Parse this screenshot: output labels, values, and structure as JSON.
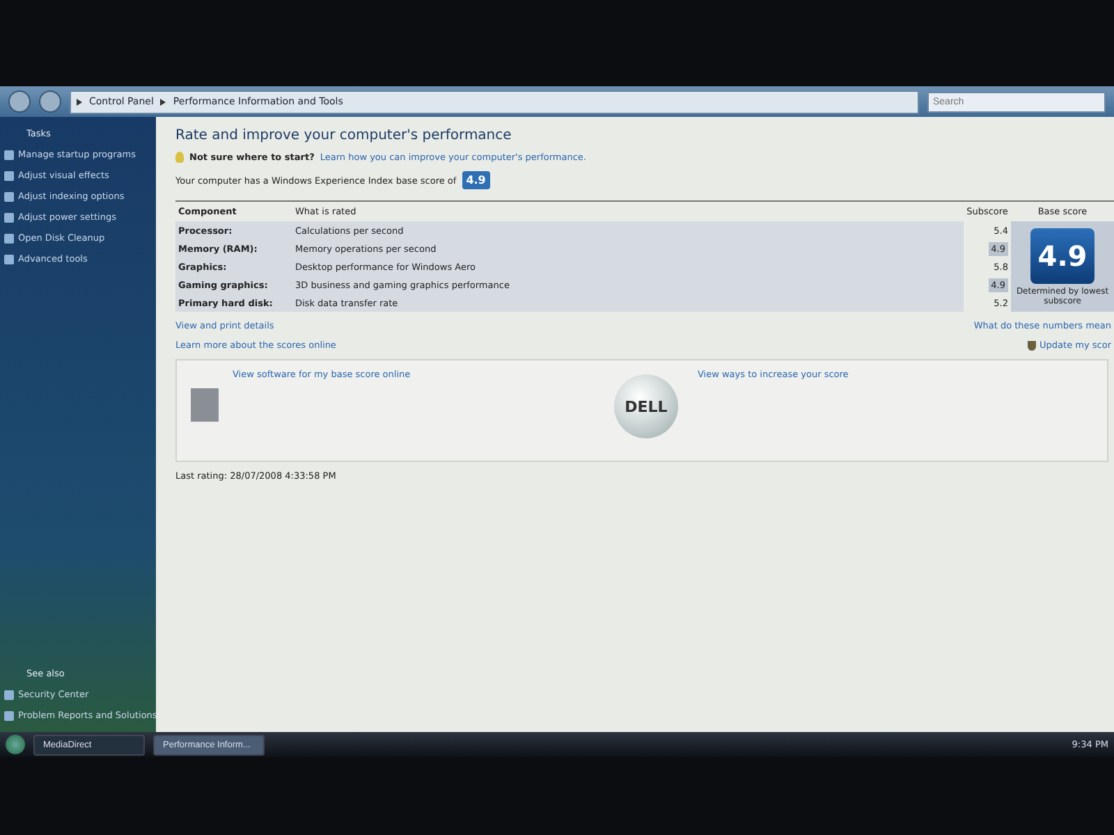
{
  "address_bar": {
    "breadcrumbs": [
      "Control Panel",
      "Performance Information and Tools"
    ],
    "search": {
      "placeholder": "Search"
    }
  },
  "sidebar": {
    "heading": "Tasks",
    "items": [
      "Manage startup programs",
      "Adjust visual effects",
      "Adjust indexing options",
      "Adjust power settings",
      "Open Disk Cleanup",
      "Advanced tools"
    ],
    "see_also": {
      "heading": "See also",
      "items": [
        "Security Center",
        "Problem Reports and Solutions"
      ]
    }
  },
  "content": {
    "title": "Rate and improve your computer's performance",
    "tip": {
      "label": "Not sure where to start?",
      "link": "Learn how you can improve your computer's performance."
    },
    "base_score_text": "Your computer has a Windows Experience Index base score of",
    "base_score_badge": "4.9",
    "table": {
      "columns": [
        "Component",
        "What is rated",
        "Subscore",
        "Base score"
      ],
      "rows": [
        {
          "component": "Processor:",
          "rated": "Calculations per second",
          "subscore": "5.4",
          "lowest": false
        },
        {
          "component": "Memory (RAM):",
          "rated": "Memory operations per second",
          "subscore": "4.9",
          "lowest": true
        },
        {
          "component": "Graphics:",
          "rated": "Desktop performance for Windows Aero",
          "subscore": "5.8",
          "lowest": false
        },
        {
          "component": "Gaming graphics:",
          "rated": "3D business and gaming graphics performance",
          "subscore": "4.9",
          "lowest": true
        },
        {
          "component": "Primary hard disk:",
          "rated": "Disk data transfer rate",
          "subscore": "5.2",
          "lowest": false
        }
      ],
      "base_score": "4.9",
      "base_caption": "Determined by lowest subscore"
    },
    "links_left": [
      "View and print details",
      "Learn more about the scores online"
    ],
    "links_right": [
      "What do these numbers mean",
      "Update my scor"
    ],
    "offers": [
      "View software for my base score online",
      "View ways to increase your score"
    ],
    "offer_logo": "DELL",
    "last_rating": "Last rating: 28/07/2008 4:33:58 PM"
  },
  "taskbar": {
    "buttons": [
      {
        "label": "MediaDirect",
        "selected": false
      },
      {
        "label": "Performance Inform...",
        "selected": true
      }
    ],
    "clock": "9:34 PM"
  }
}
